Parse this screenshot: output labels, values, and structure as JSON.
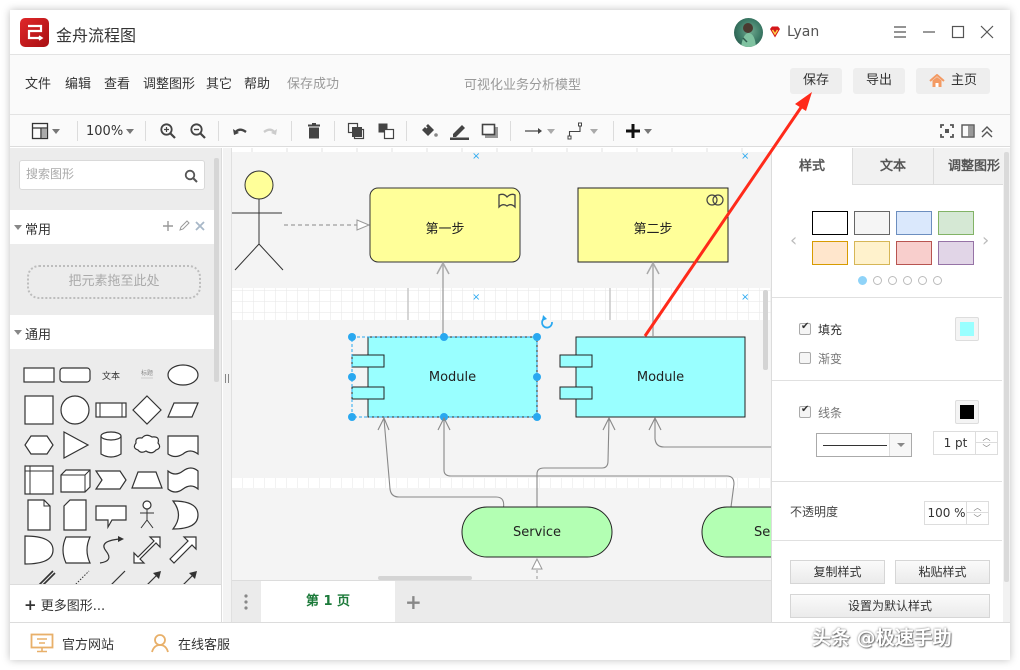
{
  "app": {
    "title": "金舟流程图",
    "user_name": "Lyan",
    "window_controls": [
      "menu-icon",
      "minimize-icon",
      "maximize-icon",
      "close-icon"
    ]
  },
  "menubar": {
    "items": [
      "文件",
      "编辑",
      "查看",
      "调整图形",
      "其它",
      "帮助"
    ],
    "status": "保存成功",
    "doc_title": "可视化业务分析模型",
    "buttons": {
      "save": "保存",
      "export": "导出",
      "home": "主页"
    }
  },
  "toolbar": {
    "zoom": "100%",
    "icons": [
      "layout-icon",
      "zoom-in-icon",
      "zoom-out-icon",
      "undo-icon",
      "redo-icon",
      "delete-icon",
      "to-front-icon",
      "to-back-icon",
      "fill-color-icon",
      "line-color-icon",
      "shadow-icon",
      "connection-arrow-icon",
      "waypoint-icon",
      "insert-plus-icon",
      "fullscreen-icon",
      "format-panel-icon",
      "collapse-icon"
    ]
  },
  "left_panel": {
    "search_placeholder": "搜索图形",
    "sections": [
      {
        "label": "常用",
        "drop_hint": "把元素拖至此处"
      },
      {
        "label": "通用"
      }
    ],
    "shape_text_label": "文本",
    "shape_heading_label": "标题",
    "more_shapes": "更多图形..."
  },
  "canvas": {
    "nodes": [
      {
        "id": "step1",
        "label": "第一步",
        "type": "process-rounded",
        "fill": "#ffff99"
      },
      {
        "id": "step2",
        "label": "第二步",
        "type": "process",
        "fill": "#ffff99"
      },
      {
        "id": "module1",
        "label": "Module",
        "type": "component",
        "fill": "#99ffff",
        "selected": true
      },
      {
        "id": "module2",
        "label": "Module",
        "type": "component",
        "fill": "#99ffff"
      },
      {
        "id": "service1",
        "label": "Service",
        "type": "terminator",
        "fill": "#b3ffb3"
      },
      {
        "id": "service2",
        "label": "Se",
        "type": "terminator",
        "fill": "#b3ffb3"
      }
    ],
    "actor": {
      "type": "actor",
      "fill": "#ffff99"
    }
  },
  "page_tabs": {
    "active": "第 1 页"
  },
  "right_panel": {
    "tabs": [
      "样式",
      "文本",
      "调整图形"
    ],
    "active_tab": "样式",
    "swatches": [
      {
        "fill": "#ffffff",
        "stroke": "#000000"
      },
      {
        "fill": "#f5f5f5",
        "stroke": "#666666"
      },
      {
        "fill": "#dae8fc",
        "stroke": "#6c8ebf"
      },
      {
        "fill": "#d5e8d4",
        "stroke": "#82b366"
      },
      {
        "fill": "#ffe6cc",
        "stroke": "#d79b00"
      },
      {
        "fill": "#fff2cc",
        "stroke": "#d6b656"
      },
      {
        "fill": "#f8cecc",
        "stroke": "#b85450"
      },
      {
        "fill": "#e1d5e7",
        "stroke": "#9673a6"
      }
    ],
    "swatch_pages": 6,
    "swatch_page_active": 1,
    "fill": {
      "label": "填充",
      "checked": true,
      "color": "#99ffff"
    },
    "gradient": {
      "label": "渐变",
      "checked": false
    },
    "line": {
      "label": "线条",
      "checked": true,
      "color": "#000000",
      "width": "1 pt"
    },
    "opacity": {
      "label": "不透明度",
      "value": "100 %"
    },
    "buttons": {
      "copy_style": "复制样式",
      "paste_style": "粘贴样式",
      "set_default": "设置为默认样式"
    }
  },
  "statusbar": {
    "website": "官方网站",
    "support": "在线客服"
  },
  "watermark": "头条 @极速手助",
  "accent_colors": {
    "brand_red": "#d0191c",
    "selection_blue": "#29a8f0",
    "annotation_red": "#ff2a1a",
    "page_tab_green": "#1c7a3a",
    "status_icon_orange": "#e8b06a"
  }
}
